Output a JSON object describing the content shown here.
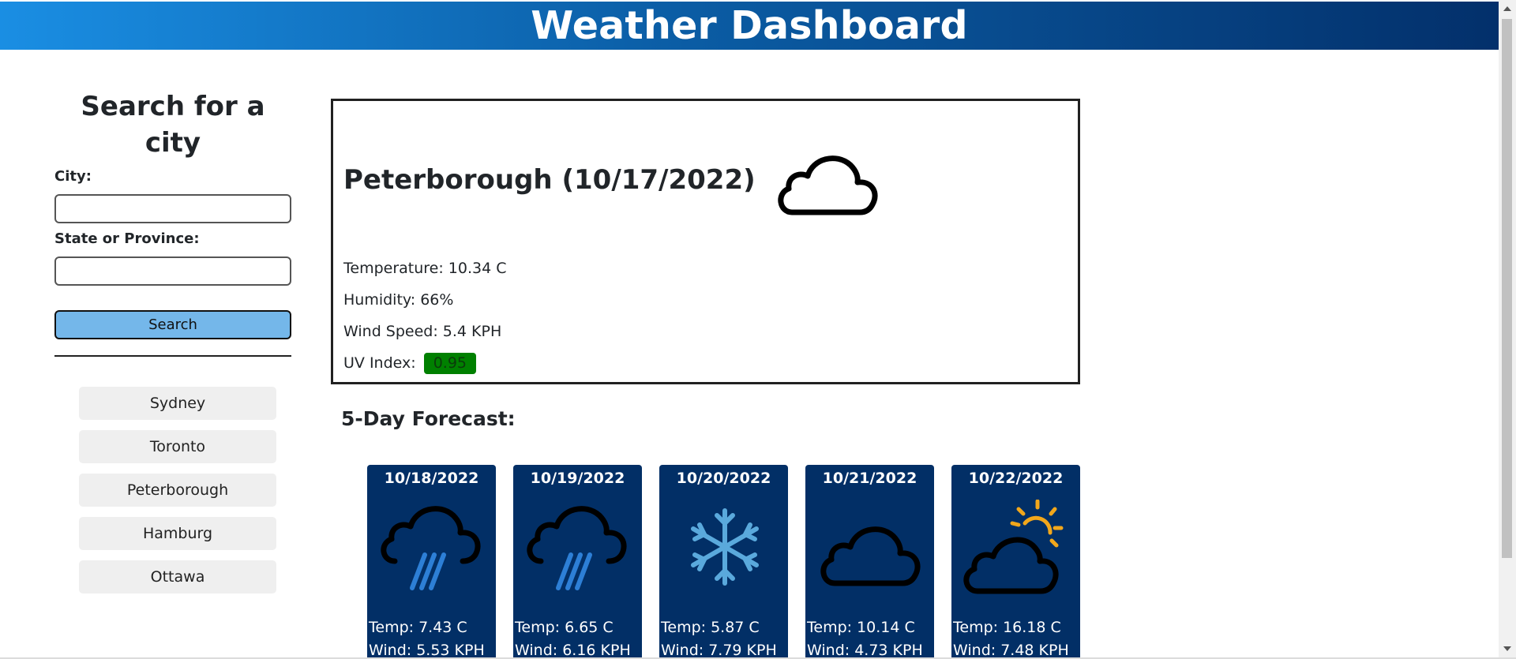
{
  "header": {
    "title": "Weather Dashboard"
  },
  "search": {
    "title": "Search for a city",
    "city_label": "City:",
    "city_value": "",
    "state_label": "State or Province:",
    "state_value": "",
    "button_label": "Search"
  },
  "history": [
    {
      "label": "Sydney"
    },
    {
      "label": "Toronto"
    },
    {
      "label": "Peterborough"
    },
    {
      "label": "Hamburg"
    },
    {
      "label": "Ottawa"
    }
  ],
  "current": {
    "title": "Peterborough (10/17/2022)",
    "icon": "cloud-icon",
    "temperature": "Temperature: 10.34 C",
    "humidity": "Humidity: 66%",
    "wind": "Wind Speed: 5.4 KPH",
    "uv_label": "UV Index:",
    "uv_value": "0.95",
    "uv_color": "#008000"
  },
  "forecast": {
    "title": "5-Day Forecast:",
    "card_color": "#022f66",
    "days": [
      {
        "date": "10/18/2022",
        "icon": "rain-cloud-icon",
        "temp": "Temp: 7.43 C",
        "wind": "Wind: 5.53 KPH"
      },
      {
        "date": "10/19/2022",
        "icon": "rain-cloud-icon",
        "temp": "Temp: 6.65 C",
        "wind": "Wind: 6.16 KPH"
      },
      {
        "date": "10/20/2022",
        "icon": "snowflake-icon",
        "temp": "Temp: 5.87 C",
        "wind": "Wind: 7.79 KPH"
      },
      {
        "date": "10/21/2022",
        "icon": "cloud-icon",
        "temp": "Temp: 10.14 C",
        "wind": "Wind: 4.73 KPH"
      },
      {
        "date": "10/22/2022",
        "icon": "sun-behind-cloud-icon",
        "temp": "Temp: 16.18 C",
        "wind": "Wind: 7.48 KPH"
      }
    ]
  },
  "colors": {
    "header_start": "#1a8ee3",
    "header_end": "#03306b",
    "search_button": "#74b7ea",
    "history_button": "#efefef"
  }
}
